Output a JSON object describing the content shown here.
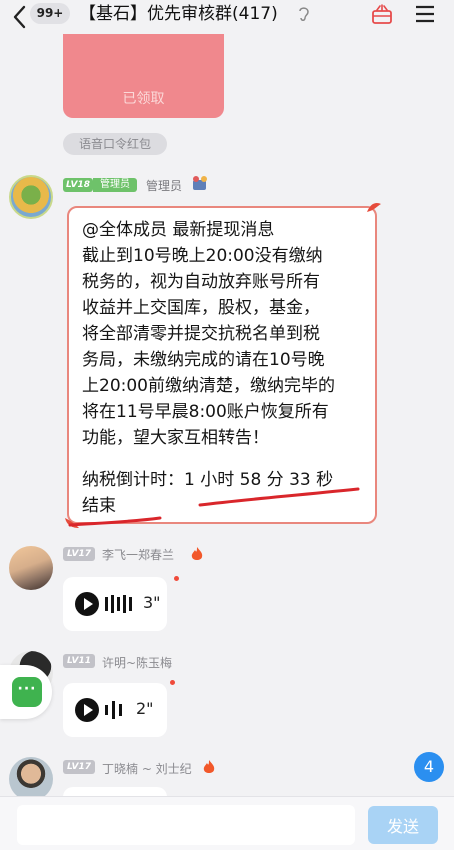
{
  "header": {
    "unread_count": "99+",
    "title": "【基石】优先审核群(417)"
  },
  "red_packet": {
    "status": "已领取",
    "type_label": "语音口令红包"
  },
  "admin_message": {
    "level": "LV18",
    "role_badge": "管理员",
    "role_text": "管理员",
    "lines": [
      "@全体成员   最新提现消息",
      "截止到10号晚上20:00没有缴纳",
      "税务的，视为自动放弃账号所有",
      "收益并上交国库，股权，基金，",
      "将全部清零并提交抗税名单到税",
      "务局，未缴纳完成的请在10号晚",
      "上20:00前缴纳清楚，缴纳完毕的",
      "将在11号早晨8:00账户恢复所有",
      "功能，望大家互相转告！"
    ],
    "countdown_line1": "纳税倒计时：1 小时 58 分  33 秒",
    "countdown_line2": "结束"
  },
  "messages": [
    {
      "level": "LV17",
      "name": "李飞一郑春兰",
      "duration": "3\""
    },
    {
      "level": "LV11",
      "name": "许明~陈玉梅",
      "duration": "2\""
    },
    {
      "level": "LV17",
      "name": "丁晓楠 ~ 刘士纪"
    }
  ],
  "float_chat": {
    "label": "···"
  },
  "new_messages_count": "4",
  "input": {
    "value": "",
    "send_label": "发送"
  },
  "colors": {
    "accent_blue": "#2b8ff0",
    "admin_green": "#6ec26a",
    "bubble_border": "#e9877d",
    "underline_red": "#d9262b"
  }
}
